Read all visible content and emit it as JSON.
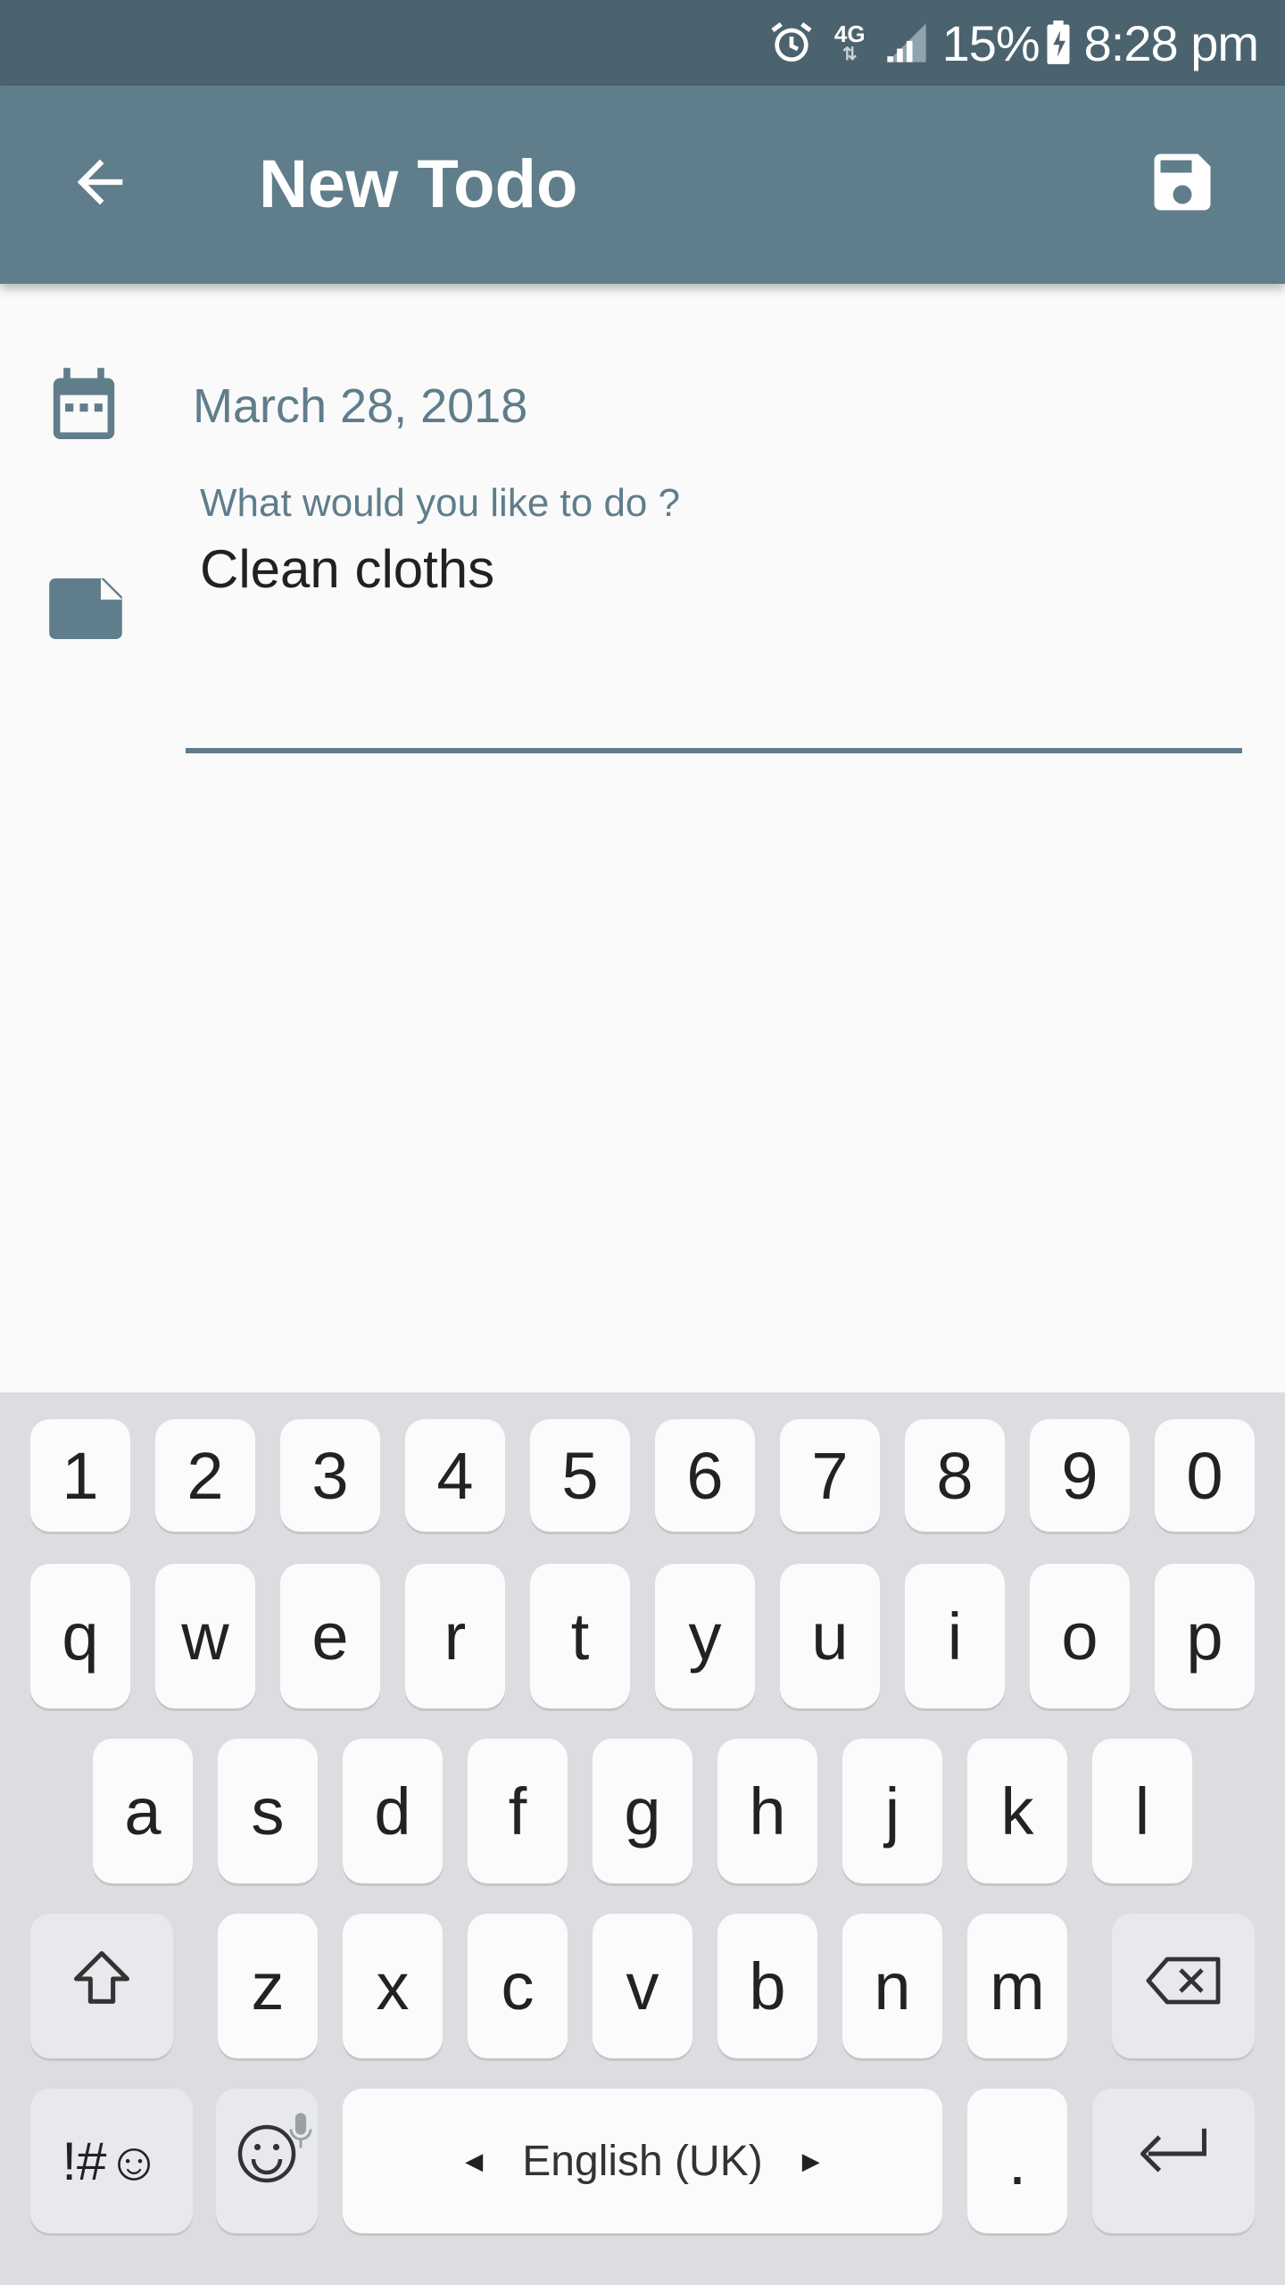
{
  "status_bar": {
    "network": "4G",
    "battery": "15%",
    "time": "8:28 pm",
    "icons": [
      "alarm-icon",
      "network-4g-icon",
      "signal-icon",
      "battery-charging-icon"
    ]
  },
  "app_bar": {
    "title": "New Todo",
    "back_icon": "arrow-back-icon",
    "save_icon": "floppy-save-icon",
    "color": "#607d8b",
    "status_color": "#4b636f"
  },
  "form": {
    "date": "March 28, 2018",
    "task_label": "What would you like to do ?",
    "task_value": "Clean cloths",
    "date_icon": "calendar-icon",
    "task_icon": "note-icon",
    "accent": "#607d8b"
  },
  "keyboard": {
    "number_row": [
      "1",
      "2",
      "3",
      "4",
      "5",
      "6",
      "7",
      "8",
      "9",
      "0"
    ],
    "row1": [
      "q",
      "w",
      "e",
      "r",
      "t",
      "y",
      "u",
      "i",
      "o",
      "p"
    ],
    "row2": [
      "a",
      "s",
      "d",
      "f",
      "g",
      "h",
      "j",
      "k",
      "l"
    ],
    "row3": [
      "z",
      "x",
      "c",
      "v",
      "b",
      "n",
      "m"
    ],
    "symbols_label": "!#☺",
    "space_label": "English (UK)",
    "period_label": ".",
    "icons": [
      "shift-icon",
      "backspace-icon",
      "emoji-icon",
      "mic-icon",
      "enter-icon"
    ]
  }
}
